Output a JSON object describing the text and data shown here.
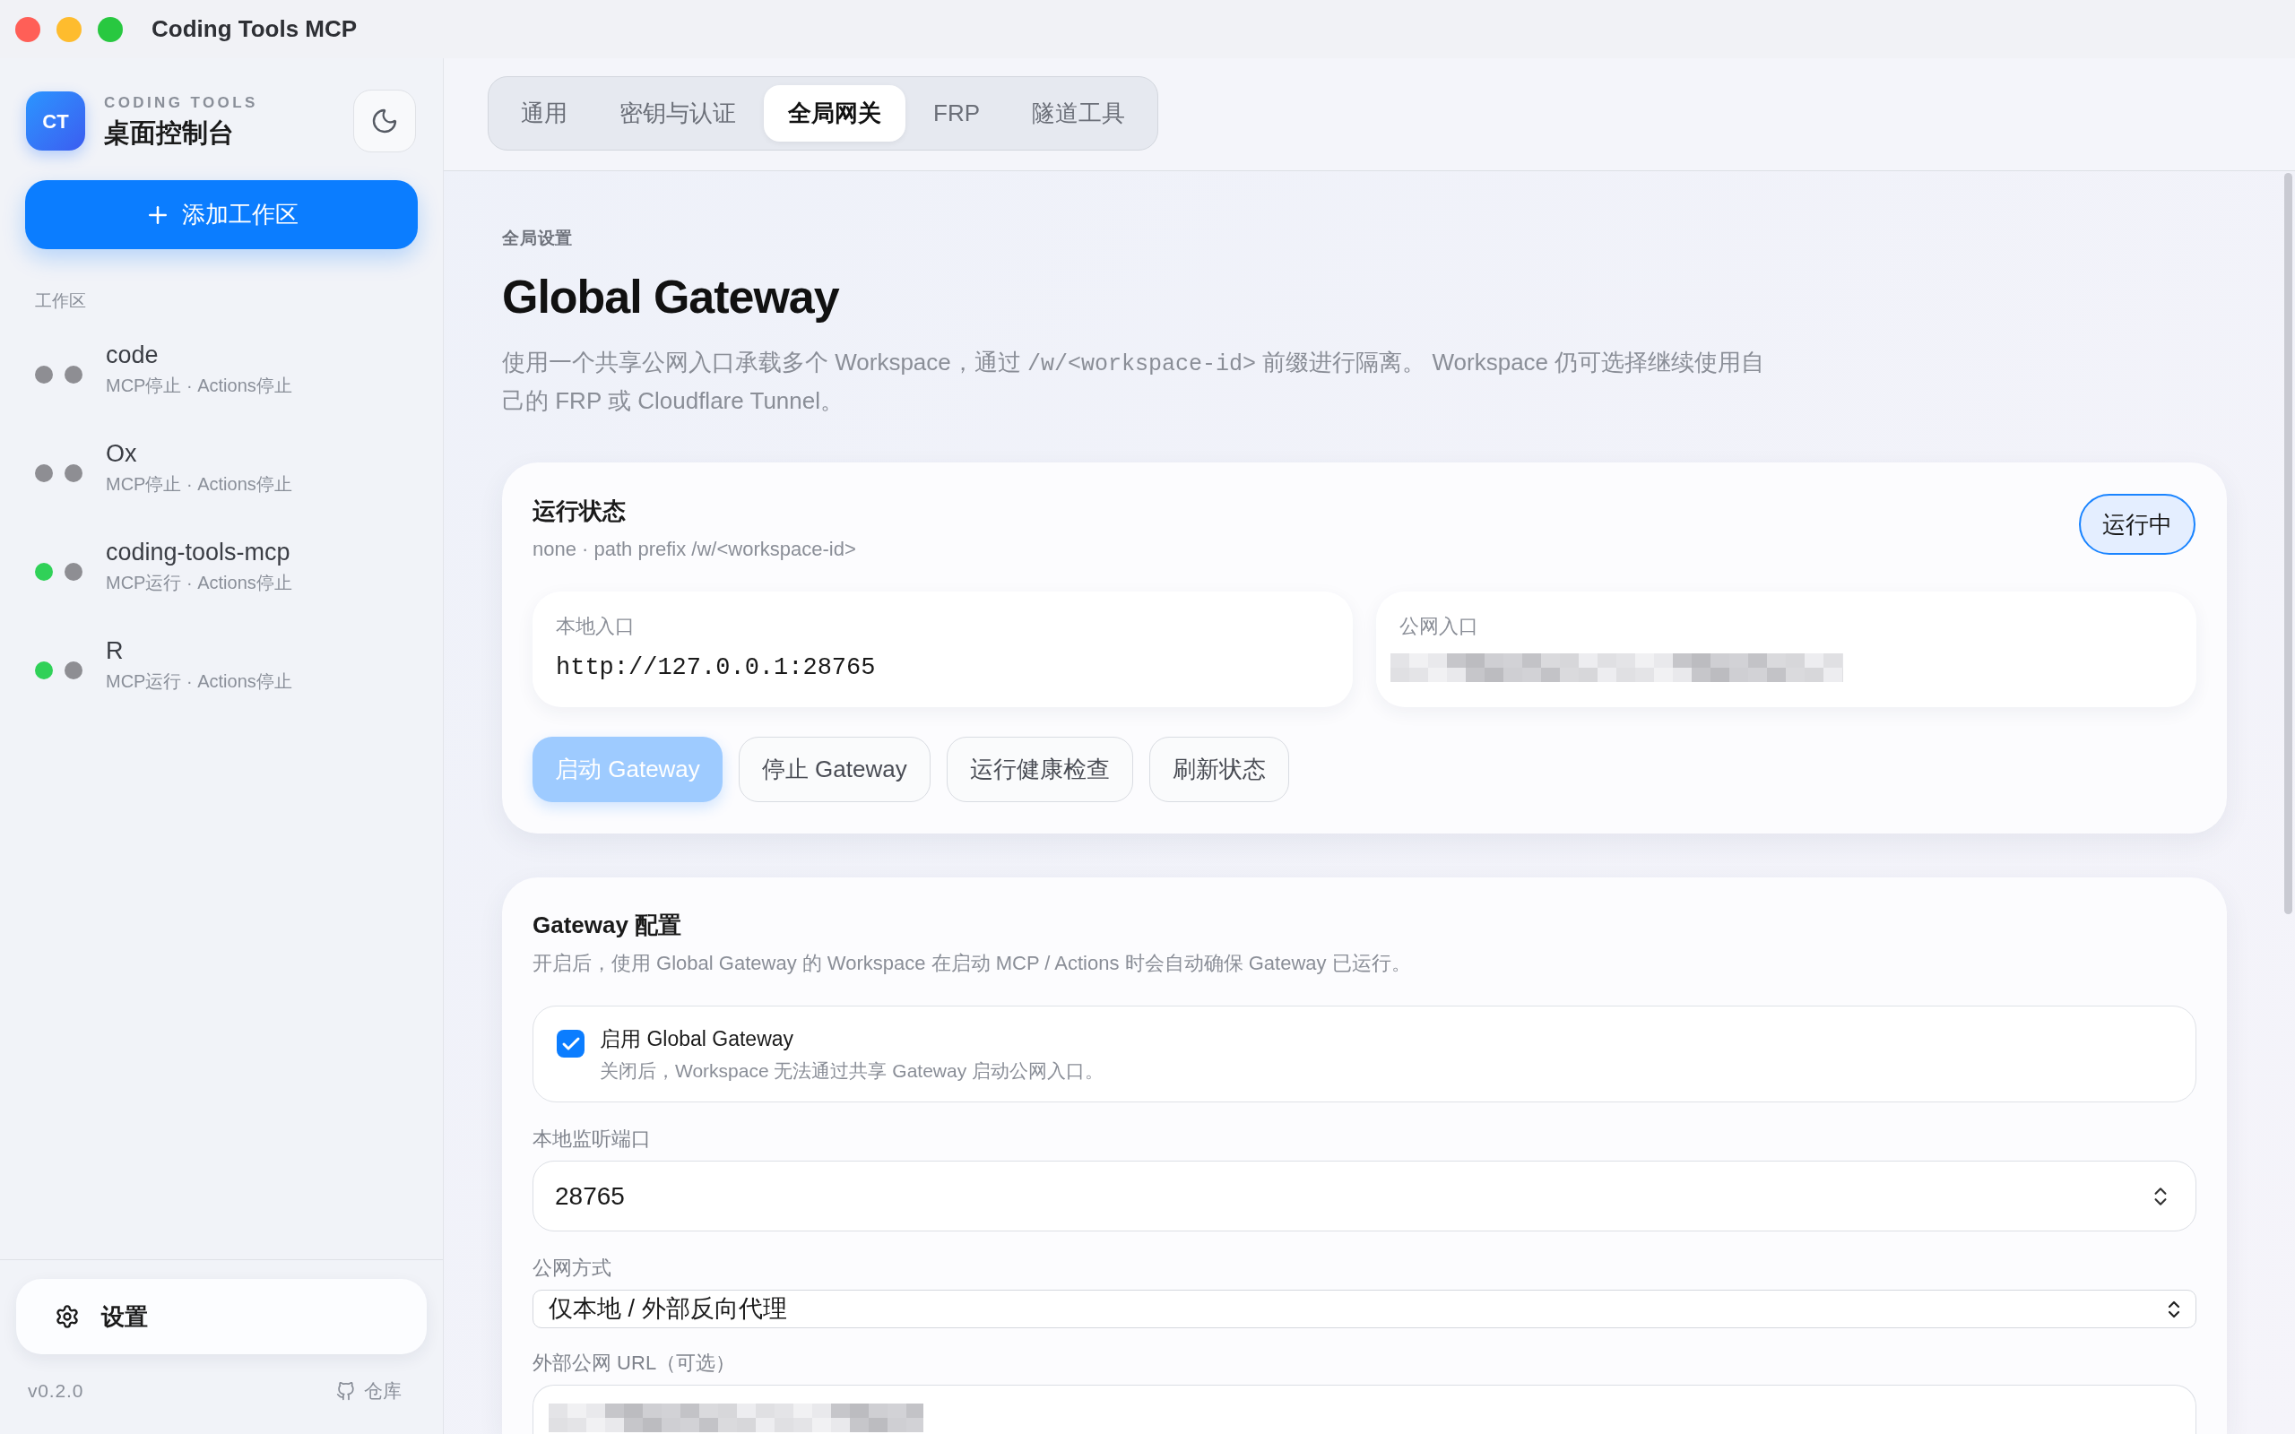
{
  "window": {
    "title": "Coding Tools MCP"
  },
  "sidebar": {
    "brand": {
      "logo": "CT",
      "eyebrow": "CODING TOOLS",
      "title": "桌面控制台"
    },
    "add_button": "添加工作区",
    "section_label": "工作区",
    "workspaces": [
      {
        "name": "code",
        "status": "MCP停止 · Actions停止",
        "indicators": [
          {
            "color": "#8e8e93"
          },
          {
            "color": "#8e8e93"
          }
        ]
      },
      {
        "name": "Ox",
        "status": "MCP停止 · Actions停止",
        "indicators": [
          {
            "color": "#8e8e93"
          },
          {
            "color": "#8e8e93"
          }
        ]
      },
      {
        "name": "coding-tools-mcp",
        "status": "MCP运行 · Actions停止",
        "indicators": [
          {
            "color": "#30d158"
          },
          {
            "color": "#8e8e93"
          }
        ]
      },
      {
        "name": "R",
        "status": "MCP运行 · Actions停止",
        "indicators": [
          {
            "color": "#30d158"
          },
          {
            "color": "#8e8e93"
          }
        ]
      }
    ],
    "settings_button": "设置",
    "version": "v0.2.0",
    "repo_link": "仓库"
  },
  "tabs": [
    {
      "label": "通用",
      "selected": false
    },
    {
      "label": "密钥与认证",
      "selected": false
    },
    {
      "label": "全局网关",
      "selected": true
    },
    {
      "label": "FRP",
      "selected": false
    },
    {
      "label": "隧道工具",
      "selected": false
    }
  ],
  "page": {
    "eyebrow": "全局设置",
    "title": "Global Gateway",
    "description": [
      {
        "kind": "text",
        "text": "使用一个共享公网入口承载多个 Workspace，通过 "
      },
      {
        "kind": "code",
        "text": "/w/<workspace-id>"
      },
      {
        "kind": "text",
        "text": " 前缀进行隔离。 Workspace 仍可选择继续使用自己的 FRP 或 Cloudflare Tunnel。"
      }
    ]
  },
  "status_card": {
    "title": "运行状态",
    "subtitle": "none · path prefix /w/<workspace-id>",
    "badge": "运行中",
    "entries": [
      {
        "kind": "text",
        "label": "本地入口",
        "value": "http://127.0.0.1:28765"
      },
      {
        "kind": "obscured",
        "label": "公网入口"
      }
    ],
    "buttons": [
      {
        "kind": "primary",
        "label": "启动 Gateway",
        "disabled": true
      },
      {
        "kind": "secondary",
        "label": "停止 Gateway",
        "disabled": false
      },
      {
        "kind": "secondary",
        "label": "运行健康检查",
        "disabled": false
      },
      {
        "kind": "secondary",
        "label": "刷新状态",
        "disabled": false
      }
    ]
  },
  "config_card": {
    "title": "Gateway 配置",
    "description": "开启后，使用 Global Gateway 的 Workspace 在启动 MCP / Actions 时会自动确保 Gateway 已运行。",
    "toggle": {
      "label": "启用 Global Gateway",
      "hint": "关闭后，Workspace 无法通过共享 Gateway 启动公网入口。",
      "checked": true
    },
    "fields": [
      {
        "kind": "number",
        "label": "本地监听端口",
        "value": "28765"
      },
      {
        "kind": "select",
        "label": "公网方式",
        "value": "仅本地 / 外部反向代理"
      },
      {
        "kind": "obscured",
        "label": "外部公网 URL（可选）"
      }
    ]
  }
}
